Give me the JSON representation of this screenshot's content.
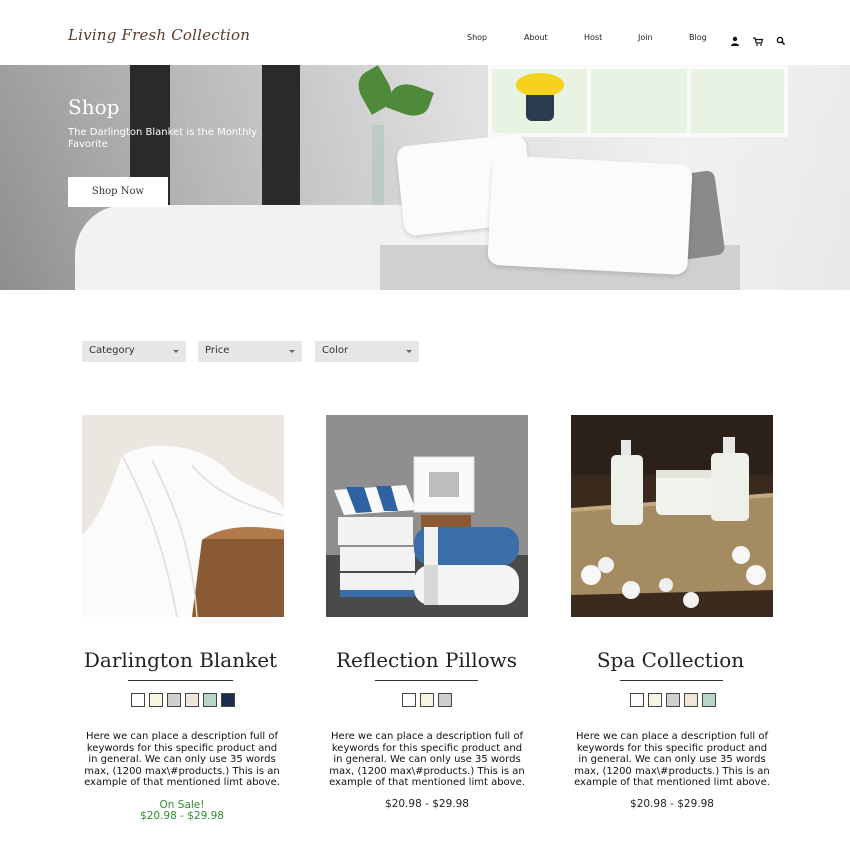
{
  "header": {
    "logo": "Living Fresh Collection",
    "nav": [
      "Shop",
      "About",
      "Host",
      "Join",
      "Blog"
    ],
    "icons": [
      "user-icon",
      "cart-icon",
      "search-icon"
    ]
  },
  "hero": {
    "title": "Shop",
    "subtitle": "The Darlington Blanket is the Monthly Favorite",
    "button_label": "Shop Now"
  },
  "filters": [
    {
      "label": "Category"
    },
    {
      "label": "Price"
    },
    {
      "label": "Color"
    }
  ],
  "products": [
    {
      "title": "Darlington Blanket",
      "swatch_colors": [
        "#ffffff",
        "#f8f4e2",
        "#cfcfcf",
        "#f3e6d8",
        "#b7d6c8",
        "#1d2b4d"
      ],
      "description": "Here we can place a description full of keywords for this specific product and in general. We can only use 35 words max, (1200 max\\#products.) This is an example of that mentioned limt above.",
      "sale_label": "On Sale!",
      "price": "$20.98 - $29.98"
    },
    {
      "title": "Reflection Pillows",
      "swatch_colors": [
        "#ffffff",
        "#f8f4e2",
        "#cfcfcf"
      ],
      "description": "Here we can place a description full of keywords for this specific product and in general. We can only use 35 words max, (1200 max\\#products.) This is an example of that mentioned limt above.",
      "price": "$20.98 - $29.98"
    },
    {
      "title": "Spa Collection",
      "swatch_colors": [
        "#ffffff",
        "#f8f4e2",
        "#cfcfcf",
        "#f3e6d8",
        "#b7d6c8"
      ],
      "description": "Here we can place a description full of keywords for this specific product and in general. We can only use 35 words max, (1200 max\\#products.) This is an example of that mentioned limt above.",
      "price": "$20.98 - $29.98"
    }
  ]
}
